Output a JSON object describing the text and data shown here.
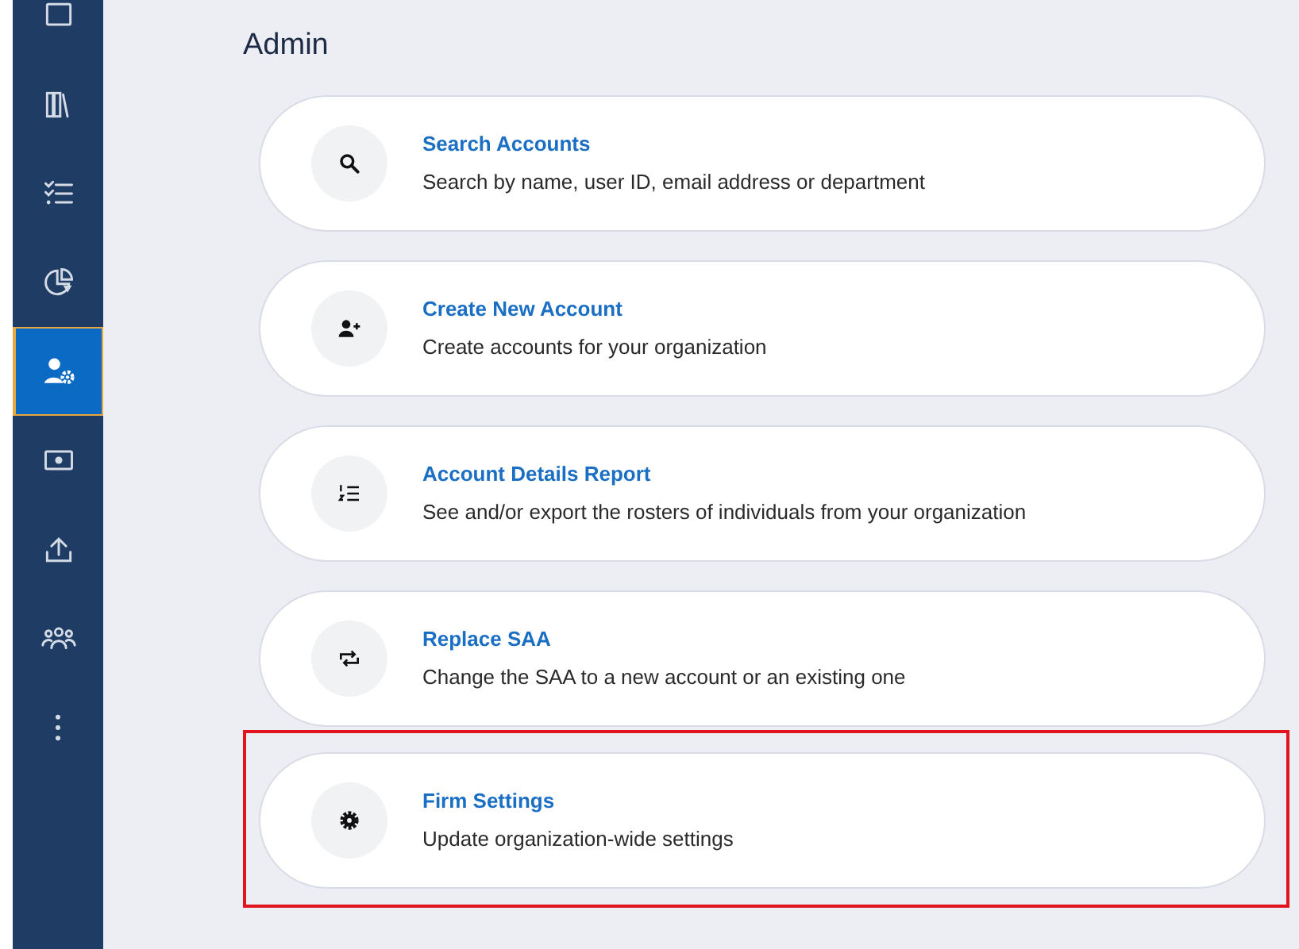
{
  "sidebar": {
    "items": [
      {
        "selected": false
      },
      {
        "selected": false
      },
      {
        "selected": false
      },
      {
        "selected": false
      },
      {
        "selected": true
      },
      {
        "selected": false
      },
      {
        "selected": false
      },
      {
        "selected": false
      },
      {
        "selected": false
      }
    ]
  },
  "page_title": "Admin",
  "cards": [
    {
      "title": "Search Accounts",
      "description": "Search by name, user ID, email address or department",
      "highlighted": false
    },
    {
      "title": "Create New Account",
      "description": "Create accounts for your organization",
      "highlighted": false
    },
    {
      "title": "Account Details Report",
      "description": "See and/or export the rosters of individuals from your organization",
      "highlighted": false
    },
    {
      "title": "Replace SAA",
      "description": "Change the SAA to a new account or an existing one",
      "highlighted": false
    },
    {
      "title": "Firm Settings",
      "description": "Update organization-wide settings",
      "highlighted": true
    }
  ]
}
